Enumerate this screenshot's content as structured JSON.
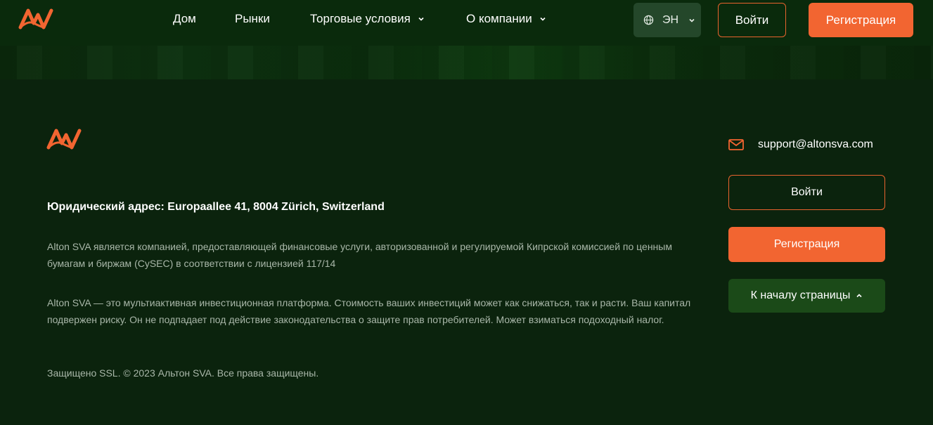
{
  "colors": {
    "background": "#0b230d",
    "header_background": "#0a2a0c",
    "accent": "#f26531",
    "secondary_button": "#1b4a18",
    "muted_text": "#a9b7a9"
  },
  "header": {
    "logo_icon": "altonsva-logo-icon",
    "nav": [
      {
        "label": "Дом",
        "has_dropdown": false
      },
      {
        "label": "Рынки",
        "has_dropdown": false
      },
      {
        "label": "Торговые условия",
        "has_dropdown": true
      },
      {
        "label": "О компании",
        "has_dropdown": true
      }
    ],
    "language": {
      "icon": "globe-icon",
      "label": "ЭН"
    },
    "login_label": "Войти",
    "register_label": "Регистрация"
  },
  "footer": {
    "logo_icon": "altonsva-logo-icon",
    "address": "Юридический адрес: Europaallee 41, 8004 Zürich, Switzerland",
    "paragraph1": "Alton SVA является компанией, предоставляющей финансовые услуги, авторизованной и регулируемой Кипрской комиссией по ценным бумагам и биржам (CySEC) в соответствии с лицензией 117/14",
    "paragraph2": "Alton SVA — это мультиактивная инвестиционная платформа. Стоимость ваших инвестиций может как снижаться, так и расти. Ваш капитал подвержен риску. Он не подпадает под действие законодательства о защите прав потребителей. Может взиматься подоходный налог.",
    "copyright": "Защищено SSL. © 2023 Альтон SVA. Все права защищены.",
    "email": {
      "icon": "mail-icon",
      "address": "support@altonsva.com"
    },
    "login_label": "Войти",
    "register_label": "Регистрация",
    "back_to_top_label": "К началу страницы"
  }
}
